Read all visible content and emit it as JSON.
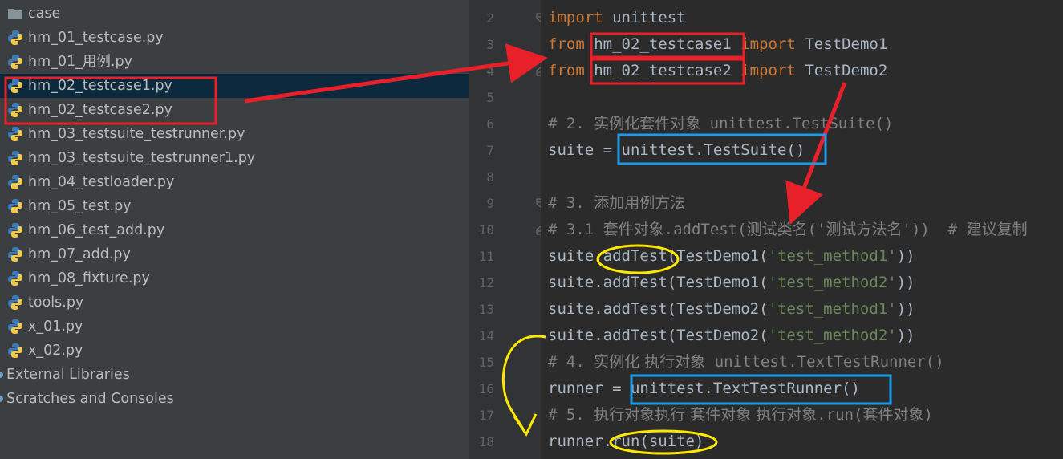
{
  "project_tree": {
    "folder": "case",
    "files": [
      "hm_01_testcase.py",
      "hm_01_用例.py",
      "hm_02_testcase1.py",
      "hm_02_testcase2.py",
      "hm_03_testsuite_testrunner.py",
      "hm_03_testsuite_testrunner1.py",
      "hm_04_testloader.py",
      "hm_05_test.py",
      "hm_06_test_add.py",
      "hm_07_add.py",
      "hm_08_fixture.py",
      "tools.py",
      "x_01.py",
      "x_02.py"
    ],
    "selected_file": "hm_02_testcase1.py",
    "external_libraries": "External Libraries",
    "scratches": "Scratches and Consoles"
  },
  "editor": {
    "line_numbers": [
      "2",
      "3",
      "4",
      "5",
      "6",
      "7",
      "8",
      "9",
      "10",
      "11",
      "12",
      "13",
      "14",
      "15",
      "16",
      "17",
      "18"
    ],
    "l2": {
      "kw": "import",
      "rest": " unittest"
    },
    "l3": {
      "kw1": "from",
      "mod": " hm_02_testcase1 ",
      "kw2": "import",
      "rest": " TestDemo1"
    },
    "l4": {
      "kw1": "from",
      "mod": " hm_02_testcase2 ",
      "kw2": "import",
      "rest": " TestDemo2"
    },
    "l6": {
      "a": "# 2. ",
      "b": "实例化套件对象",
      "c": " unittest.TestSuite()"
    },
    "l7": "suite = unittest.TestSuite()",
    "l9": {
      "a": "# 3. ",
      "b": "添加用例方法"
    },
    "l10": {
      "a": "# 3.1 ",
      "b": "套件对象",
      "c": ".addTest(",
      "d": "测试类名",
      "e": "('",
      "f": "测试方法名",
      "g": "'))  # ",
      "h": "建议复制"
    },
    "l11": {
      "a": "suite.addTest(TestDemo1(",
      "s": "'test_method1'",
      "b": "))"
    },
    "l12": {
      "a": "suite.addTest(TestDemo1(",
      "s": "'test_method2'",
      "b": "))"
    },
    "l13": {
      "a": "suite.addTest(TestDemo2(",
      "s": "'test_method1'",
      "b": "))"
    },
    "l14": {
      "a": "suite.addTest(TestDemo2(",
      "s": "'test_method2'",
      "b": "))"
    },
    "l15": {
      "a": "# 4. ",
      "b": "实例化 执行对象",
      "c": " unittest.TextTestRunner()"
    },
    "l16": "runner = unittest.TextTestRunner()",
    "l17": {
      "a": "# 5. ",
      "b": "执行对象执行 套件对象 执行对象",
      "c": ".run(",
      "d": "套件对象",
      "e": ")"
    },
    "l18": "runner.run(suite)"
  },
  "colors": {
    "tree_bg": "#3c3f41",
    "editor_bg": "#2b2b2b",
    "keyword": "#cc7832",
    "string": "#6a8759",
    "comment": "#808080",
    "annotation_red": "#e8202a",
    "annotation_blue": "#1e9be8",
    "annotation_yellow": "#ffe800"
  }
}
